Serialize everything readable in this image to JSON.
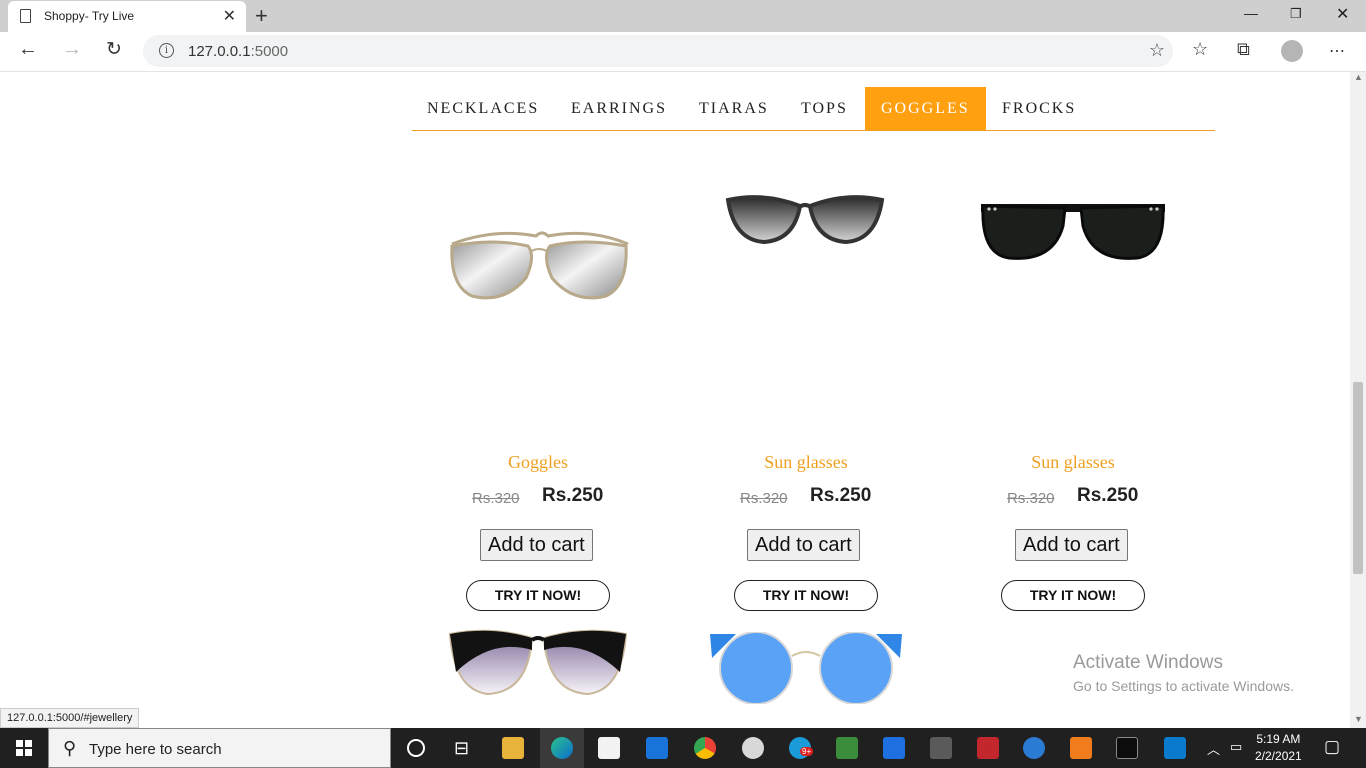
{
  "browser": {
    "tab_title": "Shoppy- Try Live",
    "url_host": "127.0.0.1",
    "url_port": ":5000",
    "status_url": "127.0.0.1:5000/#jewellery"
  },
  "nav": {
    "items": [
      "NECKLACES",
      "EARRINGS",
      "TIARAS",
      "TOPS",
      "GOGGLES",
      "FROCKS"
    ],
    "active": "GOGGLES",
    "accent_color": "#ffa011"
  },
  "products": [
    {
      "name": "Goggles",
      "old_price": "Rs.320",
      "price": "Rs.250",
      "cart_label": "Add to cart",
      "try_label": "TRY IT NOW!"
    },
    {
      "name": "Sun glasses",
      "old_price": "Rs.320",
      "price": "Rs.250",
      "cart_label": "Add to cart",
      "try_label": "TRY IT NOW!"
    },
    {
      "name": "Sun glasses",
      "old_price": "Rs.320",
      "price": "Rs.250",
      "cart_label": "Add to cart",
      "try_label": "TRY IT NOW!"
    }
  ],
  "watermark": {
    "line1": "Activate Windows",
    "line2": "Go to Settings to activate Windows."
  },
  "taskbar": {
    "search_placeholder": "Type here to search",
    "time": "5:19 AM",
    "date": "2/2/2021",
    "skype_badge": "9+"
  }
}
